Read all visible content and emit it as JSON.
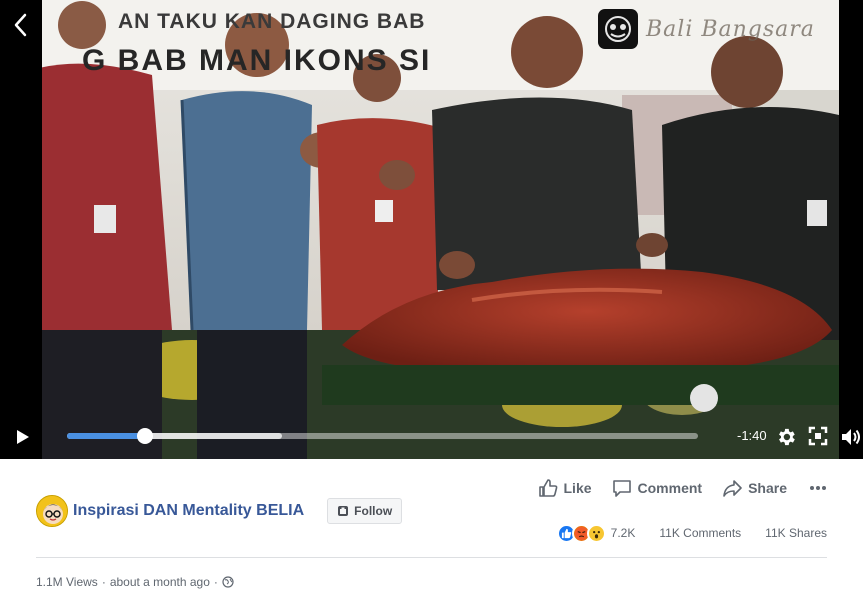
{
  "video": {
    "banner_line1": "AN TAKU  KAN DAGING BAB",
    "banner_line2": "G BAB  MAN  IKONS  SI",
    "watermark_text": "Bali Bangsara",
    "time_remaining": "-1:40",
    "progress_fraction": 0.123,
    "buffered_fraction": 0.34,
    "icons": {
      "back": "chevron-left-icon",
      "play": "play-icon",
      "settings": "gear-icon",
      "fullscreen": "fullscreen-icon",
      "volume": "volume-icon"
    }
  },
  "actions": {
    "like": "Like",
    "comment": "Comment",
    "share": "Share"
  },
  "page": {
    "name": "Inspirasi DAN Mentality BELIA",
    "follow_label": "Follow"
  },
  "stats": {
    "reactions_count": "7.2K",
    "comments": "11K Comments",
    "shares": "11K Shares",
    "reaction_types": [
      "like",
      "angry",
      "wow"
    ]
  },
  "meta": {
    "views": "1.1M Views",
    "separator": "·",
    "time": "about a month ago"
  },
  "colors": {
    "link": "#385898",
    "progress": "#4a90e2",
    "secondary_text": "#606770"
  }
}
